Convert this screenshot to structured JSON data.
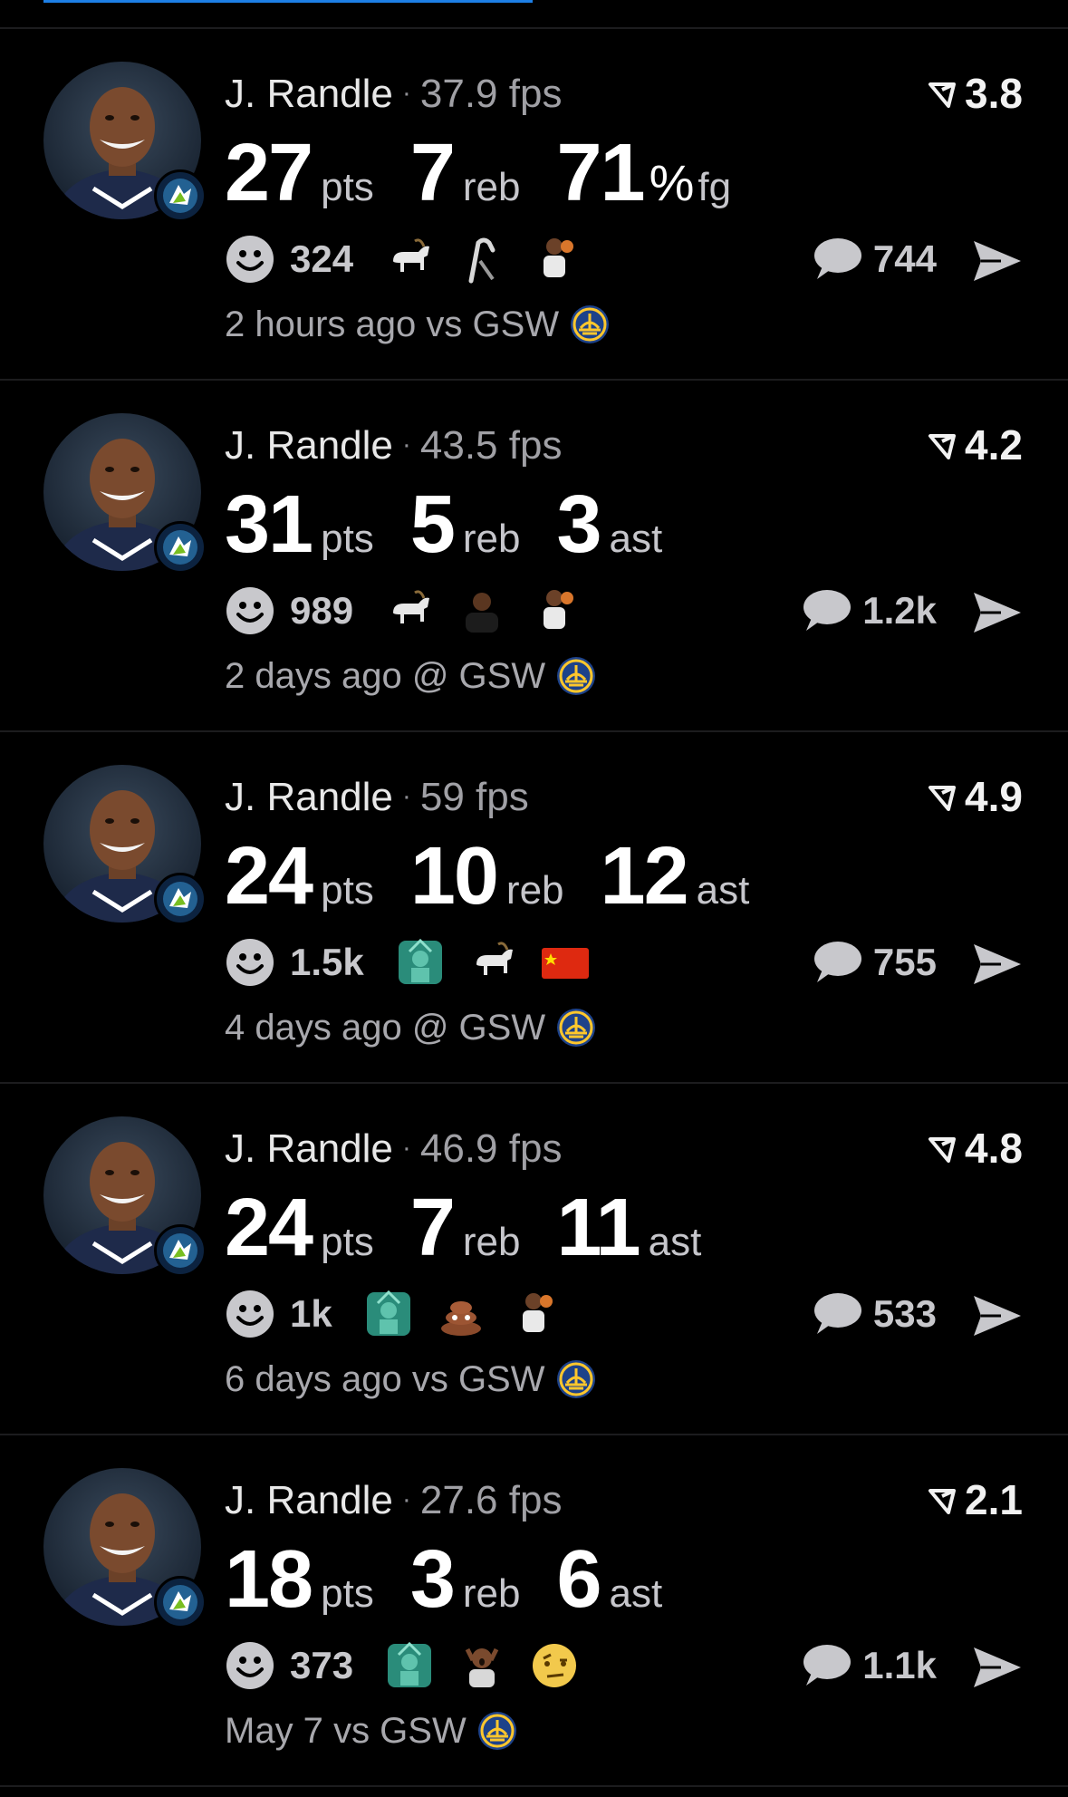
{
  "colors": {
    "background": "#000000",
    "accent": "#1d7fe6",
    "divider": "#1c1c1e",
    "muted": "#a0a0a5"
  },
  "posts": [
    {
      "player": "J. Randle",
      "fps": "37.9 fps",
      "score": "3.8",
      "stats": [
        {
          "value": "27",
          "unit": "pts"
        },
        {
          "value": "7",
          "unit": "reb"
        },
        {
          "value": "71",
          "unit": "fg",
          "percent": "%"
        }
      ],
      "reactions_count": "324",
      "reaction_icons": [
        "goat-emoji",
        "cane-emoji",
        "player-emoji"
      ],
      "comments": "744",
      "time": "2 hours ago",
      "matchup": "vs GSW"
    },
    {
      "player": "J. Randle",
      "fps": "43.5 fps",
      "score": "4.2",
      "stats": [
        {
          "value": "31",
          "unit": "pts"
        },
        {
          "value": "5",
          "unit": "reb"
        },
        {
          "value": "3",
          "unit": "ast"
        }
      ],
      "reactions_count": "989",
      "reaction_icons": [
        "goat-emoji",
        "person-emoji",
        "player-emoji"
      ],
      "comments": "1.2k",
      "time": "2 days ago",
      "matchup": "@ GSW"
    },
    {
      "player": "J. Randle",
      "fps": "59 fps",
      "score": "4.9",
      "stats": [
        {
          "value": "24",
          "unit": "pts"
        },
        {
          "value": "10",
          "unit": "reb"
        },
        {
          "value": "12",
          "unit": "ast"
        }
      ],
      "reactions_count": "1.5k",
      "reaction_icons": [
        "statue-of-liberty-emoji",
        "goat-emoji",
        "china-flag-emoji"
      ],
      "comments": "755",
      "time": "4 days ago",
      "matchup": "@ GSW"
    },
    {
      "player": "J. Randle",
      "fps": "46.9 fps",
      "score": "4.8",
      "stats": [
        {
          "value": "24",
          "unit": "pts"
        },
        {
          "value": "7",
          "unit": "reb"
        },
        {
          "value": "11",
          "unit": "ast"
        }
      ],
      "reactions_count": "1k",
      "reaction_icons": [
        "statue-of-liberty-emoji",
        "poop-emoji",
        "player-emoji"
      ],
      "comments": "533",
      "time": "6 days ago",
      "matchup": "vs GSW"
    },
    {
      "player": "J. Randle",
      "fps": "27.6 fps",
      "score": "2.1",
      "stats": [
        {
          "value": "18",
          "unit": "pts"
        },
        {
          "value": "3",
          "unit": "reb"
        },
        {
          "value": "6",
          "unit": "ast"
        }
      ],
      "reactions_count": "373",
      "reaction_icons": [
        "statue-of-liberty-emoji",
        "shocked-person-emoji",
        "raised-eyebrow-emoji"
      ],
      "comments": "1.1k",
      "time": "May 7",
      "matchup": "vs GSW"
    }
  ]
}
